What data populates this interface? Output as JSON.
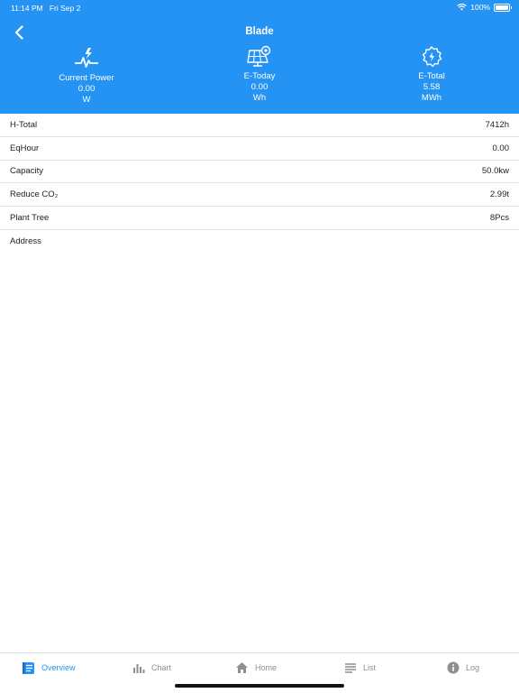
{
  "status": {
    "time": "11:14 PM",
    "date": "Fri Sep 2",
    "battery": "100%"
  },
  "nav": {
    "title": "Blade"
  },
  "stats": [
    {
      "label": "Current Power",
      "value": "0.00",
      "unit": "W",
      "icon": "power-wave-icon"
    },
    {
      "label": "E-Today",
      "value": "0.00",
      "unit": "Wh",
      "icon": "solar-panel-icon"
    },
    {
      "label": "E-Total",
      "value": "5.58",
      "unit": "MWh",
      "icon": "gear-bolt-icon"
    }
  ],
  "rows": [
    {
      "label": "H-Total",
      "value": "7412h"
    },
    {
      "label": "EqHour",
      "value": "0.00"
    },
    {
      "label": "Capacity",
      "value": "50.0kw"
    },
    {
      "label": "Reduce CO₂",
      "value": "2.99t"
    },
    {
      "label": "Plant Tree",
      "value": "8Pcs"
    },
    {
      "label": "Address",
      "value": ""
    }
  ],
  "tabs": [
    {
      "label": "Overview",
      "icon": "document-icon",
      "active": true
    },
    {
      "label": "Chart",
      "icon": "bar-chart-icon"
    },
    {
      "label": "Home",
      "icon": "home-icon"
    },
    {
      "label": "List",
      "icon": "list-icon"
    },
    {
      "label": "Log",
      "icon": "info-icon"
    }
  ],
  "colors": {
    "accent": "#2493f3",
    "inactive": "#8e8e93"
  }
}
